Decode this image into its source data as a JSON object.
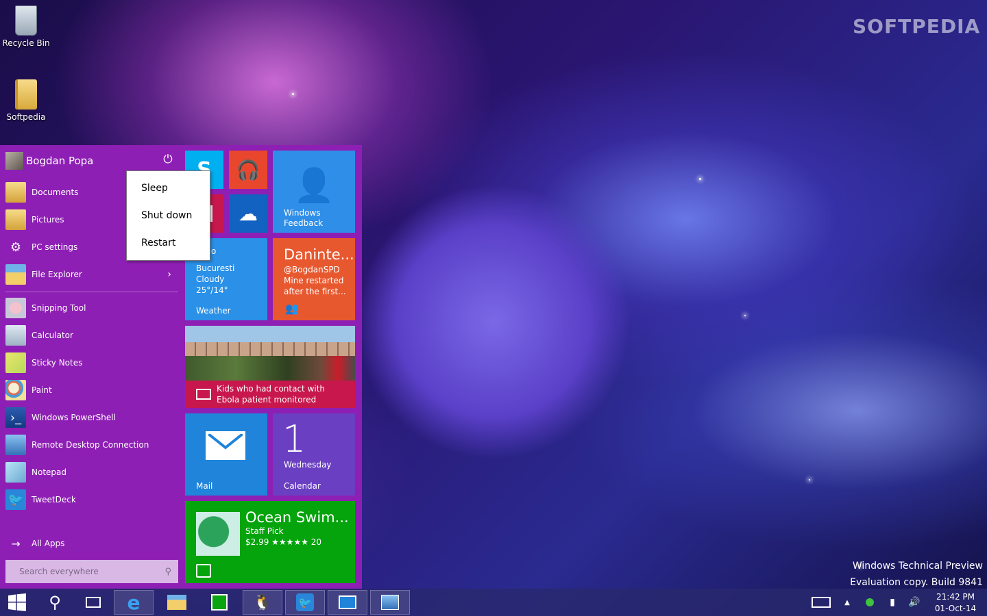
{
  "watermark": "SOFTPEDIA",
  "desktop_icons": [
    {
      "label": "Recycle Bin"
    },
    {
      "label": "Softpedia"
    }
  ],
  "start_menu": {
    "user_name": "Bogdan Popa",
    "places": [
      {
        "label": "Documents"
      },
      {
        "label": "Pictures"
      },
      {
        "label": "PC settings"
      },
      {
        "label": "File Explorer"
      }
    ],
    "apps": [
      {
        "label": "Snipping Tool"
      },
      {
        "label": "Calculator"
      },
      {
        "label": "Sticky Notes"
      },
      {
        "label": "Paint"
      },
      {
        "label": "Windows PowerShell"
      },
      {
        "label": "Remote Desktop Connection"
      },
      {
        "label": "Notepad"
      },
      {
        "label": "TweetDeck"
      }
    ],
    "all_apps_label": "All Apps",
    "search_placeholder": "Search everywhere"
  },
  "power_menu": {
    "items": [
      {
        "label": "Sleep"
      },
      {
        "label": "Shut down"
      },
      {
        "label": "Restart"
      }
    ]
  },
  "tiles": {
    "feedback": {
      "label_line1": "Windows",
      "label_line2": "Feedback"
    },
    "weather": {
      "partial": "o",
      "city": "Bucuresti",
      "condition": "Cloudy",
      "temps": "25°/14°",
      "label": "Weather"
    },
    "people": {
      "title": "Daninte...",
      "line1": "@BogdanSPD",
      "line2": "Mine restarted",
      "line3": "after the first..."
    },
    "news": {
      "line1": "Kids who had contact with",
      "line2": "Ebola patient monitored"
    },
    "mail": {
      "label": "Mail"
    },
    "calendar": {
      "day": "1",
      "weekday": "Wednesday",
      "label": "Calendar"
    },
    "store": {
      "title": "Ocean Swim...",
      "line1": "Staff Pick",
      "line2": "$2.99 ★★★★★ 20"
    }
  },
  "eval_text": {
    "line1": "Windows Technical Preview",
    "line2": "Evaluation copy. Build 9841"
  },
  "clock": {
    "time": "21:42 PM",
    "date": "01-Oct-14"
  },
  "colors": {
    "start_bg": "#8e1fb4",
    "taskbar": "#28286e"
  }
}
